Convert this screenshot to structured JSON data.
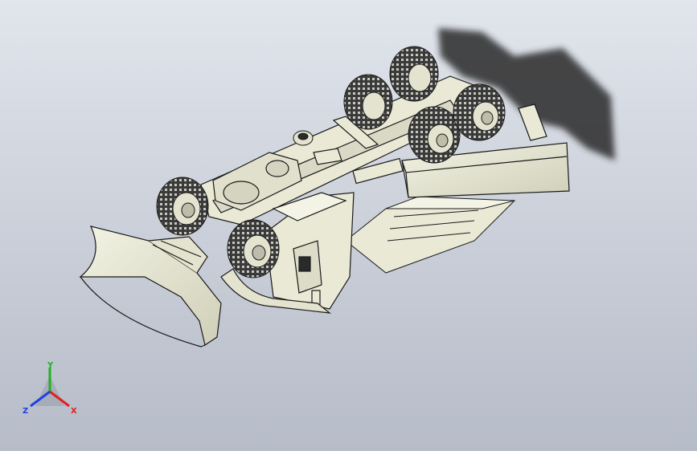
{
  "viewport": {
    "background_top": "#e1e5ec",
    "background_bottom": "#b6bcc8",
    "model": {
      "description_icon": "snowplow-truck-3d-model",
      "body_color": "#e9e9d6",
      "edge_color": "#1a1a1a",
      "tire_color": "#2a2a2a",
      "shadow_color": "#2b2b2b"
    }
  },
  "triad": {
    "x_label": "X",
    "y_label": "Y",
    "z_label": "Z",
    "x_color": "#e02020",
    "y_color": "#20b020",
    "z_color": "#2040e0"
  }
}
